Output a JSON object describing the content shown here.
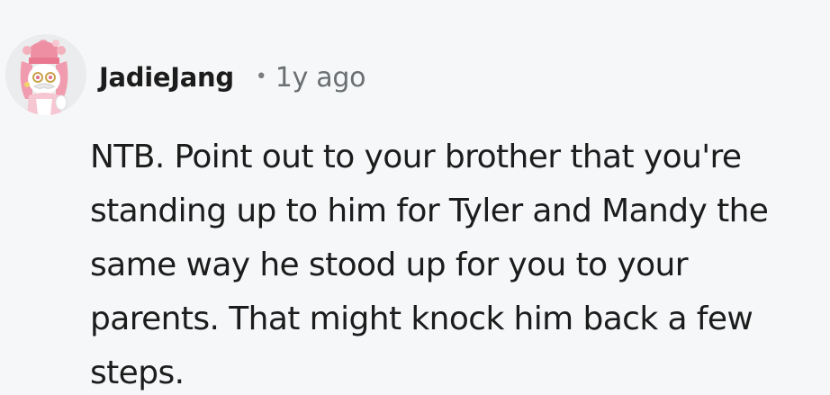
{
  "comment": {
    "avatar_icon": "snoo-avatar-pink-chef-hat",
    "username": "JadieJang",
    "separator": "•",
    "timestamp": "1y ago",
    "body": "NTB. Point out to your brother that you're standing up to him for Tyler and Mandy the same way he stood up for you to your parents. That might knock him back a few steps."
  }
}
